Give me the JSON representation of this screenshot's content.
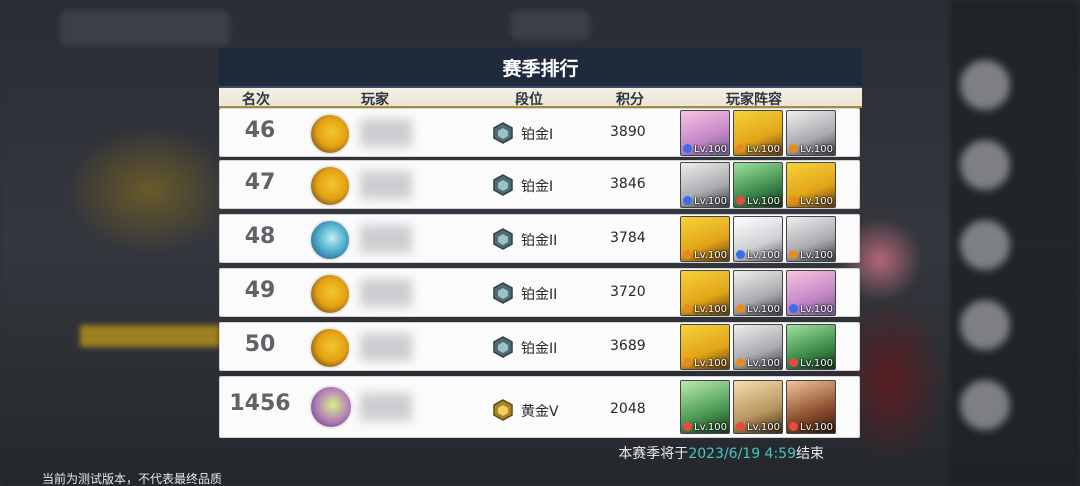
{
  "title": "赛季排行",
  "headers": {
    "rank": "名次",
    "player": "玩家",
    "tier": "段位",
    "score": "积分",
    "team": "玩家阵容"
  },
  "rows": [
    {
      "rank": "46",
      "tier": "铂金I",
      "score": "3890",
      "lv": [
        "Lv.100",
        "Lv.100",
        "Lv.100"
      ]
    },
    {
      "rank": "47",
      "tier": "铂金I",
      "score": "3846",
      "lv": [
        "Lv.100",
        "Lv.100",
        "Lv.100"
      ]
    },
    {
      "rank": "48",
      "tier": "铂金II",
      "score": "3784",
      "lv": [
        "Lv.100",
        "Lv.100",
        "Lv.100"
      ]
    },
    {
      "rank": "49",
      "tier": "铂金II",
      "score": "3720",
      "lv": [
        "Lv.100",
        "Lv.100",
        "Lv.100"
      ]
    },
    {
      "rank": "50",
      "tier": "铂金II",
      "score": "3689",
      "lv": [
        "Lv.100",
        "Lv.100",
        "Lv.100"
      ]
    },
    {
      "rank": "1456",
      "tier": "黄金V",
      "score": "2048",
      "lv": [
        "Lv.100",
        "Lv.100",
        "Lv.100"
      ]
    }
  ],
  "footer": {
    "prefix": "本赛季将于",
    "date": "2023/6/19 4:59",
    "suffix": "结束"
  },
  "test_note": "当前为测试版本，不代表最终品质",
  "colors": {
    "title_bg": "#1f2a3d",
    "accent": "#49c6c3",
    "platinum": "#5f7d86",
    "gold": "#c9a037"
  }
}
